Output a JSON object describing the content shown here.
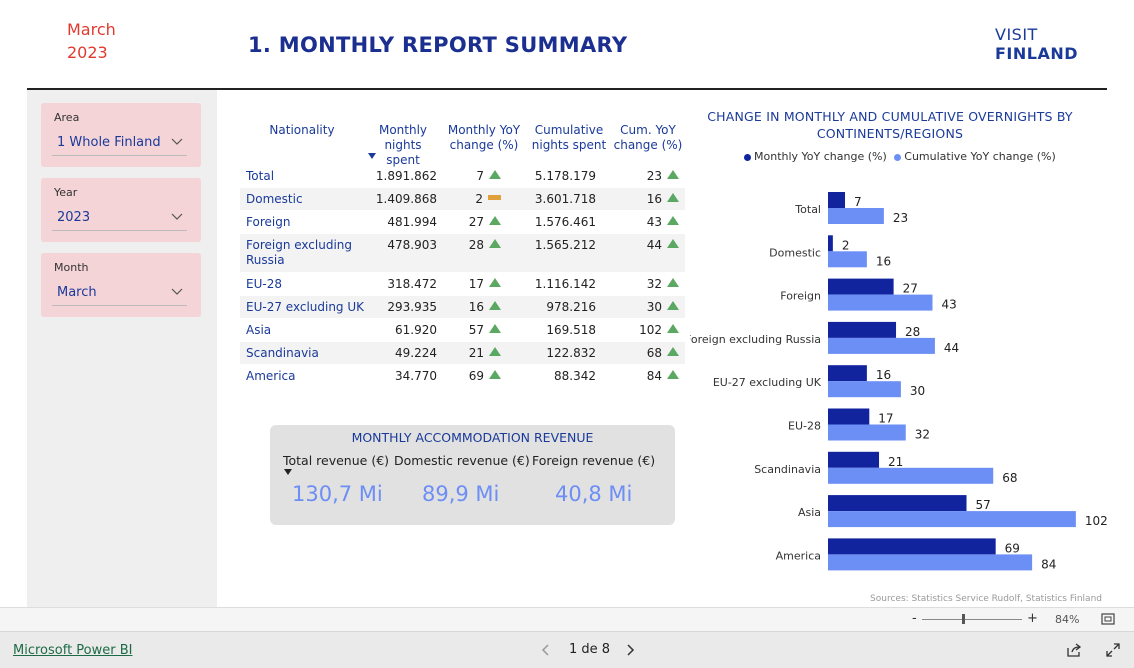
{
  "header": {
    "month": "March",
    "year": "2023",
    "title": "1. MONTHLY REPORT SUMMARY",
    "logo_line1": "VISIT",
    "logo_line2": "FINLAND"
  },
  "filters": [
    {
      "label": "Area",
      "value": "1 Whole Finland"
    },
    {
      "label": "Year",
      "value": "2023"
    },
    {
      "label": "Month",
      "value": "March"
    }
  ],
  "table": {
    "headers": [
      "Nationality",
      "Monthly nights spent",
      "Monthly YoY change (%)",
      "Cumulative nights spent",
      "Cum. YoY change (%)"
    ],
    "rows": [
      {
        "name": "Total",
        "monthly": "1.891.862",
        "myoy": "7",
        "mtrend": "up",
        "cum": "5.178.179",
        "cyoy": "23",
        "ctrend": "up"
      },
      {
        "name": "Domestic",
        "monthly": "1.409.868",
        "myoy": "2",
        "mtrend": "flat",
        "cum": "3.601.718",
        "cyoy": "16",
        "ctrend": "up"
      },
      {
        "name": "Foreign",
        "monthly": "481.994",
        "myoy": "27",
        "mtrend": "up",
        "cum": "1.576.461",
        "cyoy": "43",
        "ctrend": "up"
      },
      {
        "name": "Foreign excluding Russia",
        "monthly": "478.903",
        "myoy": "28",
        "mtrend": "up",
        "cum": "1.565.212",
        "cyoy": "44",
        "ctrend": "up"
      },
      {
        "name": "EU-28",
        "monthly": "318.472",
        "myoy": "17",
        "mtrend": "up",
        "cum": "1.116.142",
        "cyoy": "32",
        "ctrend": "up"
      },
      {
        "name": "EU-27 excluding UK",
        "monthly": "293.935",
        "myoy": "16",
        "mtrend": "up",
        "cum": "978.216",
        "cyoy": "30",
        "ctrend": "up"
      },
      {
        "name": "Asia",
        "monthly": "61.920",
        "myoy": "57",
        "mtrend": "up",
        "cum": "169.518",
        "cyoy": "102",
        "ctrend": "up"
      },
      {
        "name": "Scandinavia",
        "monthly": "49.224",
        "myoy": "21",
        "mtrend": "up",
        "cum": "122.832",
        "cyoy": "68",
        "ctrend": "up"
      },
      {
        "name": "America",
        "monthly": "34.770",
        "myoy": "69",
        "mtrend": "up",
        "cum": "88.342",
        "cyoy": "84",
        "ctrend": "up"
      }
    ]
  },
  "revenue": {
    "title": "MONTHLY ACCOMMODATION REVENUE",
    "total_label": "Total revenue (€)",
    "domestic_label": "Domestic revenue (€)",
    "foreign_label": "Foreign revenue (€)",
    "total_value": "130,7 Mi",
    "domestic_value": "89,9 Mi",
    "foreign_value": "40,8 Mi"
  },
  "chart_data": {
    "type": "bar",
    "orientation": "horizontal",
    "title": "CHANGE IN MONTHLY AND CUMULATIVE OVERNIGHTS BY CONTINENTS/REGIONS",
    "categories": [
      "Total",
      "Domestic",
      "Foreign",
      "Foreign excluding Russia",
      "EU-27 excluding UK",
      "EU-28",
      "Scandinavia",
      "Asia",
      "America"
    ],
    "series": [
      {
        "name": "Monthly YoY change (%)",
        "color": "#12239e",
        "values": [
          7,
          2,
          27,
          28,
          16,
          17,
          21,
          57,
          69
        ]
      },
      {
        "name": "Cumulative YoY change (%)",
        "color": "#6b8ff5",
        "values": [
          23,
          16,
          43,
          44,
          30,
          32,
          68,
          102,
          84
        ]
      }
    ],
    "xlim": [
      0,
      110
    ],
    "legend_position": "top"
  },
  "footer": {
    "source": "Sources: Statistics Service Rudolf, Statistics Finland",
    "zoom": "84%",
    "zoom_minus": "-",
    "zoom_plus": "+",
    "app_link": "Microsoft Power BI",
    "page_indicator": "1 de 8"
  }
}
